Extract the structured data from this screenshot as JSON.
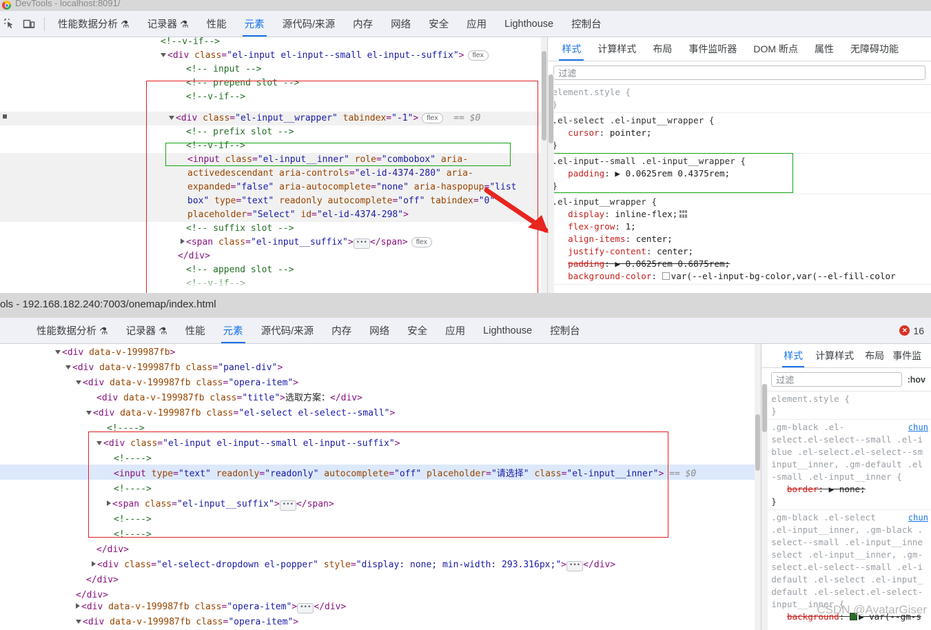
{
  "window": {
    "top_title": "DevTools - localhost:8091/",
    "mid_title": "ols - 192.168.182.240:7003/onemap/index.html"
  },
  "toolbar_top": {
    "icons": [
      "inspect-element-icon",
      "device-toolbar-icon"
    ],
    "tabs": [
      {
        "label": "性能数据分析",
        "flask": "⚗",
        "selected": false
      },
      {
        "label": "记录器",
        "flask": "⚗",
        "selected": false
      },
      {
        "label": "性能",
        "flask": "",
        "selected": false
      },
      {
        "label": "元素",
        "flask": "",
        "selected": true
      },
      {
        "label": "源代码/来源",
        "flask": "",
        "selected": false
      },
      {
        "label": "内存",
        "flask": "",
        "selected": false
      },
      {
        "label": "网络",
        "flask": "",
        "selected": false
      },
      {
        "label": "安全",
        "flask": "",
        "selected": false
      },
      {
        "label": "应用",
        "flask": "",
        "selected": false
      },
      {
        "label": "Lighthouse",
        "flask": "",
        "selected": false
      },
      {
        "label": "控制台",
        "flask": "",
        "selected": false
      }
    ]
  },
  "toolbar_bottom": {
    "tabs": [
      {
        "label": "性能数据分析",
        "flask": "⚗",
        "selected": false
      },
      {
        "label": "记录器",
        "flask": "⚗",
        "selected": false
      },
      {
        "label": "性能",
        "flask": "",
        "selected": false
      },
      {
        "label": "元素",
        "flask": "",
        "selected": true
      },
      {
        "label": "源代码/来源",
        "flask": "",
        "selected": false
      },
      {
        "label": "内存",
        "flask": "",
        "selected": false
      },
      {
        "label": "网络",
        "flask": "",
        "selected": false
      },
      {
        "label": "安全",
        "flask": "",
        "selected": false
      },
      {
        "label": "应用",
        "flask": "",
        "selected": false
      },
      {
        "label": "Lighthouse",
        "flask": "",
        "selected": false
      },
      {
        "label": "控制台",
        "flask": "",
        "selected": false
      }
    ],
    "error_count": "16"
  },
  "dom_top": {
    "lines": [
      "<!--v-if-->",
      "<div class=\"el-input el-input--small el-input--suffix\"> flex",
      "<!-- input -->",
      "<!-- prepend slot -->",
      "<!--v-if-->",
      "<div class=\"el-input__wrapper\" tabindex=\"-1\"> flex  == $0",
      "<!-- prefix slot -->",
      "<!--v-if-->",
      "<input class=\"el-input__inner\" role=\"combobox\" aria-",
      "activedescendant aria-controls=\"el-id-4374-280\" aria-",
      "expanded=\"false\" aria-autocomplete=\"none\" aria-haspopup=\"list",
      "box\" type=\"text\" readonly autocomplete=\"off\" tabindex=\"0\"",
      "placeholder=\"Select\" id=\"el-id-4374-298\">",
      "<!-- suffix slot -->",
      "<span class=\"el-input__suffix\">…</span> flex",
      "</div>",
      "<!-- append slot -->",
      "<!--v-if-->"
    ],
    "attr_values": {
      "input_classes": "el-input el-input--small el-input--suffix",
      "wrapper_class": "el-input__wrapper",
      "wrapper_tabindex": "-1",
      "inner_class": "el-input__inner",
      "role": "combobox",
      "aria_controls": "el-id-4374-280",
      "aria_expanded": "false",
      "aria_autocomplete": "none",
      "aria_haspopup": "listbox",
      "type": "text",
      "autocomplete": "off",
      "tabindex": "0",
      "placeholder": "Select",
      "id": "el-id-4374-298",
      "suffix_class": "el-input__suffix",
      "selected_marker": "== $0",
      "badge": "flex"
    }
  },
  "styles_top": {
    "tabs": [
      {
        "label": "样式",
        "selected": true
      },
      {
        "label": "计算样式",
        "selected": false
      },
      {
        "label": "布局",
        "selected": false
      },
      {
        "label": "事件监听器",
        "selected": false
      },
      {
        "label": "DOM 断点",
        "selected": false
      },
      {
        "label": "属性",
        "selected": false
      },
      {
        "label": "无障碍功能",
        "selected": false
      }
    ],
    "filter_placeholder": "过滤",
    "rules": [
      {
        "selector": "element.style {",
        "close": "}",
        "decls": []
      },
      {
        "selector": ".el-select .el-input__wrapper {",
        "close": "}",
        "decls": [
          {
            "prop": "cursor",
            "value": "pointer;"
          }
        ]
      },
      {
        "selector": ".el-input--small .el-input__wrapper {",
        "close": "}",
        "decls": [
          {
            "prop": "padding",
            "value": "▶ 0.0625rem 0.4375rem;"
          }
        ],
        "highlight": "green"
      },
      {
        "selector": ".el-input__wrapper {",
        "close": "",
        "decls": [
          {
            "prop": "display",
            "value": "inline-flex;"
          },
          {
            "prop": "flex-grow",
            "value": "1;"
          },
          {
            "prop": "align-items",
            "value": "center;"
          },
          {
            "prop": "justify-content",
            "value": "center;"
          },
          {
            "prop": "padding",
            "value": "▶ 0.0625rem 0.6875rem;",
            "struck": true
          },
          {
            "prop": "background-color",
            "value": "var(--el-input-bg-color,var(--el-fill-color"
          }
        ]
      }
    ]
  },
  "dom_bottom": {
    "data_v": "data-v-199987fb",
    "title_text": "选取方案：",
    "placeholder_cn": "请选择",
    "dropdown_style": "display: none; min-width: 293.316px;",
    "selected_marker": "== $0",
    "classes": {
      "panel": "panel-div",
      "opera_item": "opera-item",
      "title": "title",
      "select": "el-select el-select--small",
      "input": "el-input el-input--small el-input--suffix",
      "inner": "el-input__inner",
      "suffix": "el-input__suffix",
      "dropdown": "el-select-dropdown el-popper"
    },
    "comment": "<!---->",
    "input_attrs": {
      "type": "text",
      "readonly": "readonly",
      "autocomplete": "off"
    }
  },
  "styles_bottom": {
    "tabs": [
      {
        "label": "样式",
        "selected": true
      },
      {
        "label": "计算样式",
        "selected": false
      },
      {
        "label": "布局",
        "selected": false
      },
      {
        "label": "事件监",
        "selected": false
      }
    ],
    "filter_placeholder": "过滤",
    "hov_label": ":hov",
    "rules": [
      {
        "selector": "element.style {",
        "close": "}",
        "decls": []
      },
      {
        "selector": ".gm-black .el-\nselect.el-select--small .el-i\nblue .el-select.el-select--sm\ninput__inner, .gm-default .el\n-small .el-input__inner {",
        "link": "chun",
        "close": "}",
        "decls": [
          {
            "prop": "border",
            "value": "▶ none;",
            "struck": true
          }
        ]
      },
      {
        "selector": ".gm-black .el-select\n.el-input__inner, .gm-black .\nselect--small .el-input__inne\nselect .el-input__inner, .gm-\nselect.el-select--small .el-i\ndefault .el-select .el-input_\ndefault .el-select.el-select-\ninput__inner {",
        "link": "chun",
        "close": "",
        "decls": [
          {
            "prop": "background",
            "value": "▶ var(--gm-s",
            "struck": true,
            "swatch": "green"
          }
        ]
      }
    ]
  },
  "watermark": "CSDN @AvatarGiser",
  "colors": {
    "accent": "#1a73e8",
    "toolbar_bg": "#eff1f7",
    "titlebar_bg": "#d8d8d8",
    "error_red": "#d93025",
    "selection_red": "#e02020",
    "selection_green": "#13a413",
    "highlight_blue": "#dce8fb"
  }
}
